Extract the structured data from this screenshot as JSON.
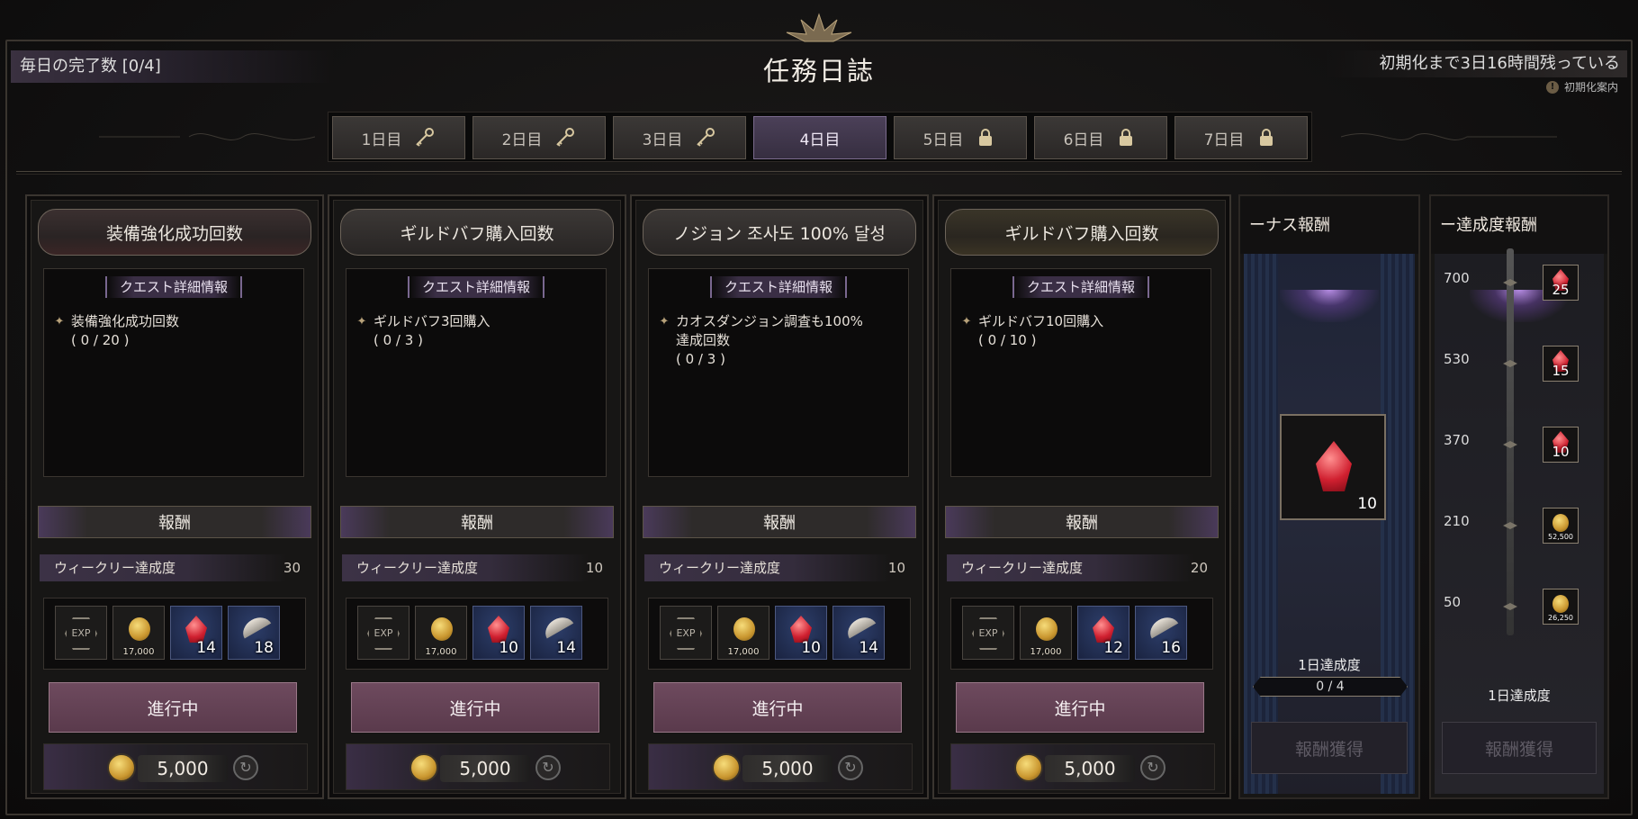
{
  "header": {
    "title": "任務日誌",
    "daily_completion": "毎日の完了数 [0/4]",
    "reset_time": "初期化まで3日16時間残っている",
    "reset_info": "初期化案内"
  },
  "tabs": [
    {
      "label": "1日目",
      "icon": "key-icon",
      "state": "unlocked"
    },
    {
      "label": "2日目",
      "icon": "key-icon",
      "state": "unlocked"
    },
    {
      "label": "3日目",
      "icon": "key-icon",
      "state": "unlocked"
    },
    {
      "label": "4日目",
      "icon": "",
      "state": "active"
    },
    {
      "label": "5日目",
      "icon": "lock-icon",
      "state": "locked"
    },
    {
      "label": "6日目",
      "icon": "lock-icon",
      "state": "locked"
    },
    {
      "label": "7日目",
      "icon": "lock-icon",
      "state": "locked"
    }
  ],
  "quests": [
    {
      "title": "装備強化成功回数",
      "detail_tag": "クエスト詳細情報",
      "detail": "装備強化成功回数\n( 0 / 20 )",
      "reward_label": "報酬",
      "weekly_label": "ウィークリー達成度",
      "weekly_value": "30",
      "items": [
        {
          "type": "exp",
          "label": "EXP",
          "count": ""
        },
        {
          "type": "gold",
          "count": "17,000"
        },
        {
          "type": "gem",
          "count": "14"
        },
        {
          "type": "feather",
          "count": "18"
        }
      ],
      "status": "進行中",
      "cost": "5,000"
    },
    {
      "title": "ギルドバフ購入回数",
      "detail_tag": "クエスト詳細情報",
      "detail": "ギルドバフ3回購入\n( 0 / 3 )",
      "reward_label": "報酬",
      "weekly_label": "ウィークリー達成度",
      "weekly_value": "10",
      "items": [
        {
          "type": "exp",
          "label": "EXP",
          "count": ""
        },
        {
          "type": "gold",
          "count": "17,000"
        },
        {
          "type": "gem",
          "count": "10"
        },
        {
          "type": "feather",
          "count": "14"
        }
      ],
      "status": "進行中",
      "cost": "5,000"
    },
    {
      "title": "ノジョン 조사도 100% 달성",
      "detail_tag": "クエスト詳細情報",
      "detail": "カオスダンジョン調査も100%\n達成回数\n( 0 / 3 )",
      "reward_label": "報酬",
      "weekly_label": "ウィークリー達成度",
      "weekly_value": "10",
      "items": [
        {
          "type": "exp",
          "label": "EXP",
          "count": ""
        },
        {
          "type": "gold",
          "count": "17,000"
        },
        {
          "type": "gem",
          "count": "10"
        },
        {
          "type": "feather",
          "count": "14"
        }
      ],
      "status": "進行中",
      "cost": "5,000"
    },
    {
      "title": "ギルドバフ購入回数",
      "detail_tag": "クエスト詳細情報",
      "detail": "ギルドバフ10回購入\n( 0 / 10 )",
      "reward_label": "報酬",
      "weekly_label": "ウィークリー達成度",
      "weekly_value": "20",
      "items": [
        {
          "type": "exp",
          "label": "EXP",
          "count": ""
        },
        {
          "type": "gold",
          "count": "17,000"
        },
        {
          "type": "gem",
          "count": "12"
        },
        {
          "type": "feather",
          "count": "16"
        }
      ],
      "status": "進行中",
      "cost": "5,000"
    }
  ],
  "bonus": {
    "title": "ーナス報酬",
    "item_count": "10",
    "daily_label": "1日達成度",
    "daily_progress": "0 / 4",
    "claim": "報酬獲得"
  },
  "weekly_reward": {
    "title": "ー達成度報酬",
    "milestones": [
      {
        "value": "700",
        "count": "25",
        "type": "gem"
      },
      {
        "value": "530",
        "count": "15",
        "type": "gem"
      },
      {
        "value": "370",
        "count": "10",
        "type": "gem"
      },
      {
        "value": "210",
        "count": "52,500",
        "type": "gold"
      },
      {
        "value": "50",
        "count": "26,250",
        "type": "gold"
      }
    ],
    "daily_label": "1日達成度",
    "claim": "報酬獲得"
  },
  "colors": {
    "accent_purple": "#4b4058",
    "progress_button": "#6e4a5e",
    "bonus_bg": "#1e2336"
  }
}
